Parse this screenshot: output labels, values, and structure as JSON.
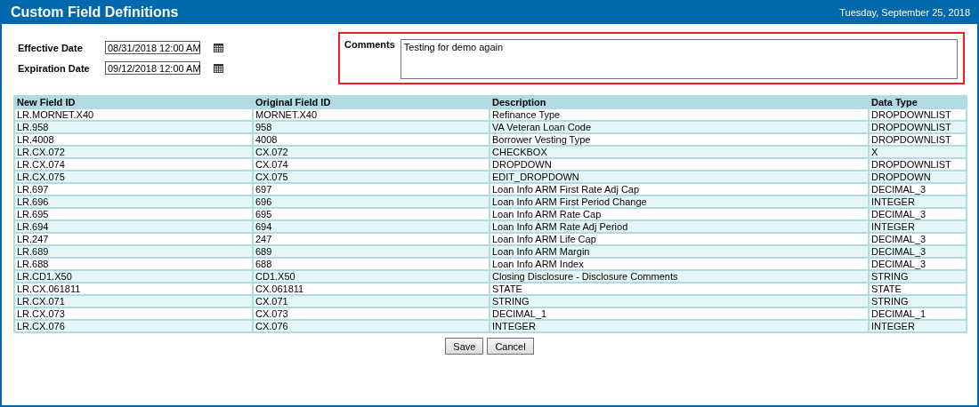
{
  "header": {
    "title": "Custom Field Definitions",
    "date": "Tuesday, September 25, 2018"
  },
  "dates": [
    {
      "label": "Effective Date",
      "value": "08/31/2018 12:00 AM"
    },
    {
      "label": "Expiration Date",
      "value": "09/12/2018 12:00 AM"
    }
  ],
  "comments": {
    "label": "Comments",
    "value": "Testing for demo again",
    "highlighted": true
  },
  "table": {
    "columns": [
      "New Field ID",
      "Original Field ID",
      "Description",
      "Data Type"
    ],
    "rows": [
      [
        "LR.MORNET.X40",
        "MORNET.X40",
        "Refinance Type",
        "DROPDOWNLIST"
      ],
      [
        "LR.958",
        "958",
        "VA Veteran Loan Code",
        "DROPDOWNLIST"
      ],
      [
        "LR.4008",
        "4008",
        "Borrower Vesting Type",
        "DROPDOWNLIST"
      ],
      [
        "LR.CX.072",
        "CX.072",
        "CHECKBOX",
        "X"
      ],
      [
        "LR.CX.074",
        "CX.074",
        "DROPDOWN",
        "DROPDOWNLIST"
      ],
      [
        "LR.CX.075",
        "CX.075",
        "EDIT_DROPDOWN",
        "DROPDOWN"
      ],
      [
        "LR.697",
        "697",
        "Loan Info ARM First Rate Adj Cap",
        "DECIMAL_3"
      ],
      [
        "LR.696",
        "696",
        "Loan Info ARM First Period Change",
        "INTEGER"
      ],
      [
        "LR.695",
        "695",
        "Loan Info ARM Rate Cap",
        "DECIMAL_3"
      ],
      [
        "LR.694",
        "694",
        "Loan Info ARM Rate Adj Period",
        "INTEGER"
      ],
      [
        "LR.247",
        "247",
        "Loan Info ARM Life Cap",
        "DECIMAL_3"
      ],
      [
        "LR.689",
        "689",
        "Loan Info ARM Margin",
        "DECIMAL_3"
      ],
      [
        "LR.688",
        "688",
        "Loan Info ARM Index",
        "DECIMAL_3"
      ],
      [
        "LR.CD1.X50",
        "CD1.X50",
        "Closing Disclosure - Disclosure Comments",
        "STRING"
      ],
      [
        "LR.CX.061811",
        "CX.061811",
        "STATE",
        "STATE"
      ],
      [
        "LR.CX.071",
        "CX.071",
        "STRING",
        "STRING"
      ],
      [
        "LR.CX.073",
        "CX.073",
        "DECIMAL_1",
        "DECIMAL_1"
      ],
      [
        "LR.CX.076",
        "CX.076",
        "INTEGER",
        "INTEGER"
      ]
    ]
  },
  "buttons": [
    "Save",
    "Cancel"
  ]
}
